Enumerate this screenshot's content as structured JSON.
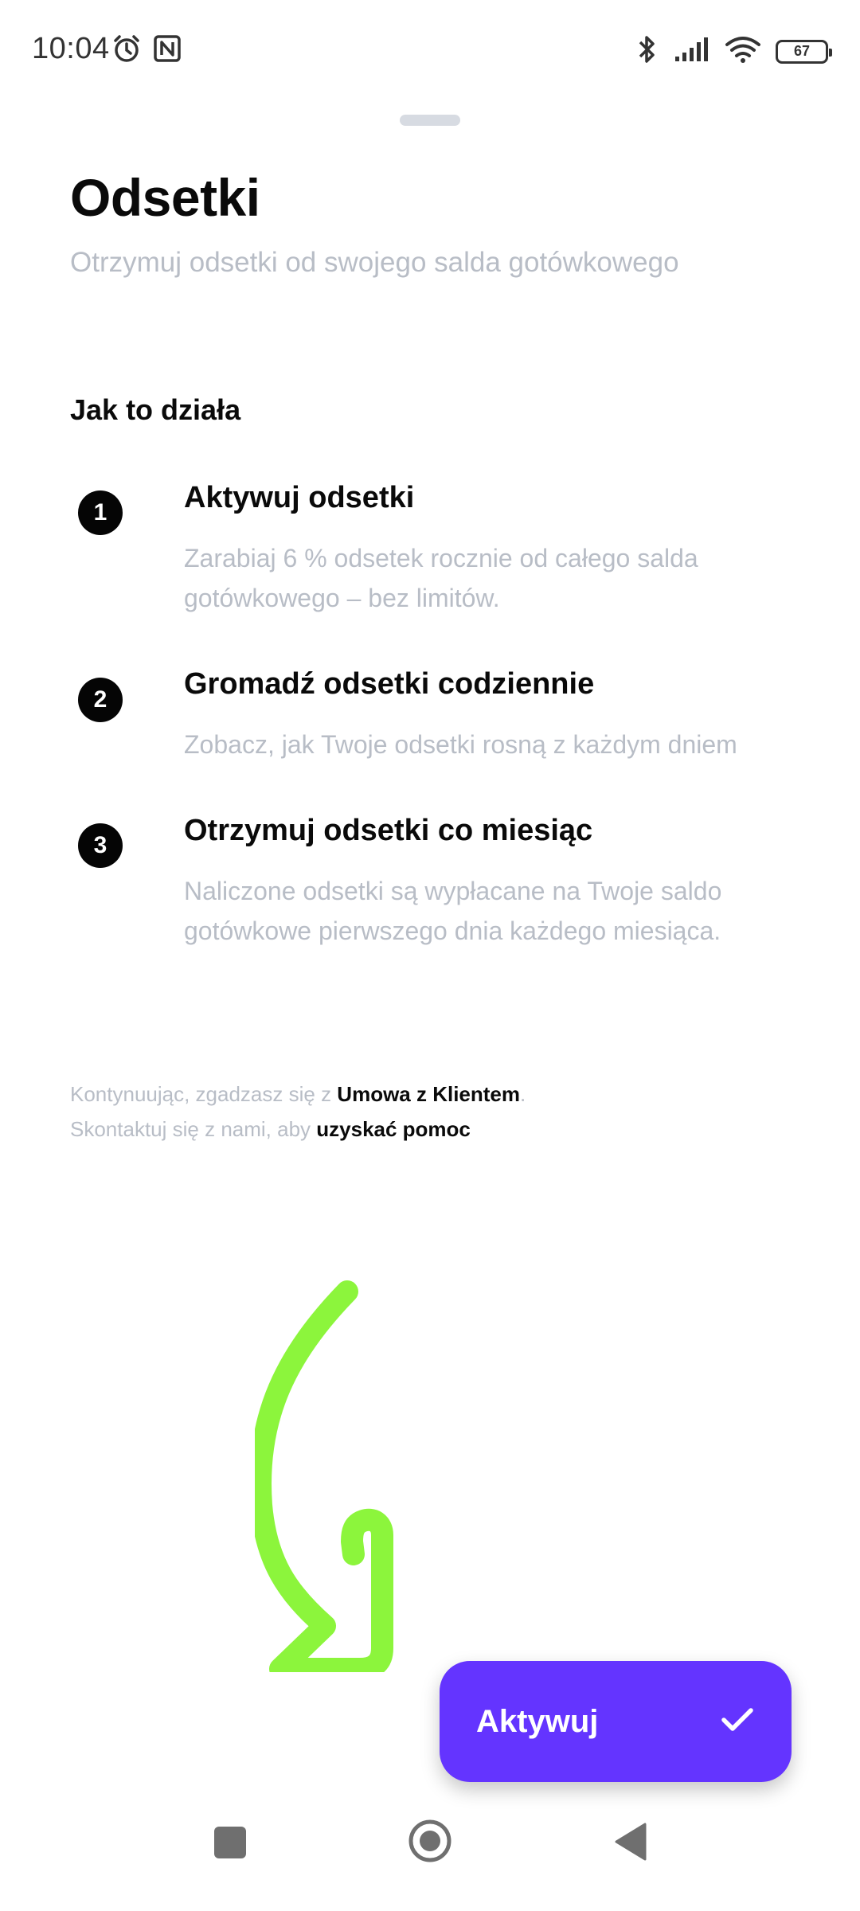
{
  "status_bar": {
    "time": "10:04",
    "battery": "67",
    "icons": [
      "alarm-icon",
      "nfc-icon",
      "bluetooth-icon",
      "signal-icon",
      "wifi-icon",
      "battery-icon"
    ]
  },
  "header": {
    "title": "Odsetki",
    "subtitle": "Otrzymuj odsetki od swojego salda gotówkowego"
  },
  "how_it_works": {
    "title": "Jak to działa",
    "steps": [
      {
        "number": "1",
        "title": "Aktywuj odsetki",
        "description": "Zarabiaj 6 % odsetek rocznie od całego salda gotówkowego – bez limitów."
      },
      {
        "number": "2",
        "title": "Gromadź odsetki codziennie",
        "description": "Zobacz, jak Twoje odsetki rosną z każdym dniem"
      },
      {
        "number": "3",
        "title": "Otrzymuj odsetki co miesiąc",
        "description": "Naliczone odsetki są wypłacane na Twoje saldo gotówkowe pierwszego dnia każdego miesiąca."
      }
    ]
  },
  "legal": {
    "line1_prefix": "Kontynuując, zgadzasz się z ",
    "line1_link": "Umowa z Klientem",
    "line1_suffix": ".",
    "line2_prefix": "Skontaktuj się z nami, aby ",
    "line2_link": "uzyskać pomoc"
  },
  "action": {
    "label": "Aktywuj",
    "icon": "check-icon",
    "color": "#6434ff"
  },
  "annotation": {
    "color": "#8cf53c"
  },
  "nav": {
    "icons": [
      "recent-apps-icon",
      "home-icon",
      "back-icon"
    ]
  }
}
